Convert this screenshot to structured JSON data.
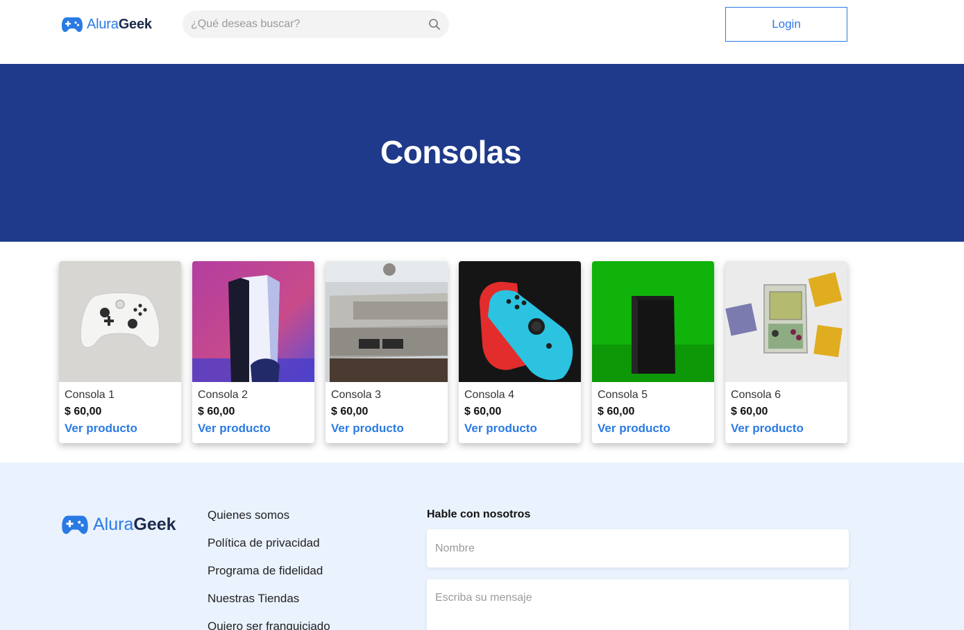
{
  "header": {
    "brand_first": "Alura",
    "brand_second": "Geek",
    "search_placeholder": "¿Qué deseas buscar?",
    "login_label": "Login"
  },
  "hero": {
    "title": "Consolas"
  },
  "products": [
    {
      "name": "Consola 1",
      "price": "$ 60,00",
      "link": "Ver producto",
      "image": "white-xbox-controller"
    },
    {
      "name": "Consola 2",
      "price": "$ 60,00",
      "link": "Ver producto",
      "image": "playstation-5"
    },
    {
      "name": "Consola 3",
      "price": "$ 60,00",
      "link": "Ver producto",
      "image": "nintendo-entertainment-system"
    },
    {
      "name": "Consola 4",
      "price": "$ 60,00",
      "link": "Ver producto",
      "image": "nintendo-switch-joycons"
    },
    {
      "name": "Consola 5",
      "price": "$ 60,00",
      "link": "Ver producto",
      "image": "xbox-series-x"
    },
    {
      "name": "Consola 6",
      "price": "$ 60,00",
      "link": "Ver producto",
      "image": "game-boy"
    }
  ],
  "footer": {
    "brand_first": "Alura",
    "brand_second": "Geek",
    "links": [
      "Quienes somos",
      "Política de privacidad",
      "Programa de fidelidad",
      "Nuestras Tiendas",
      "Quiero ser franquiciado"
    ],
    "contact_title": "Hable con nosotros",
    "name_placeholder": "Nombre",
    "message_placeholder": "Escriba su mensaje"
  },
  "colors": {
    "accent": "#2a7ae4",
    "hero_bg": "#1f3a8a",
    "footer_bg": "#eaf2fd"
  }
}
